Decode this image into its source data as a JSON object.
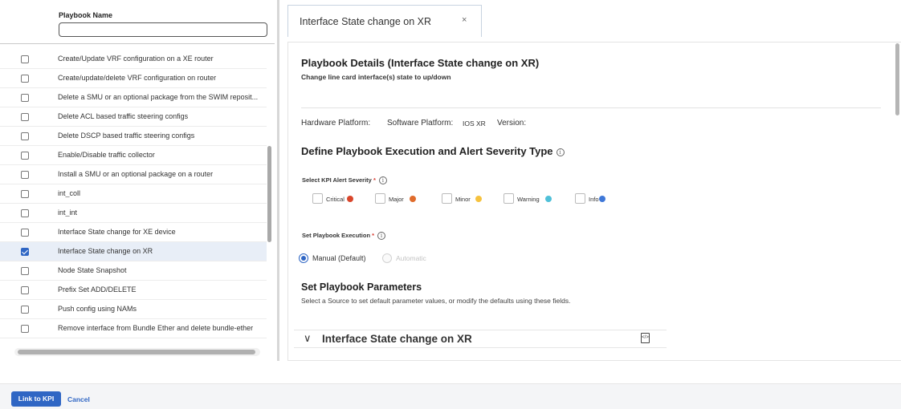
{
  "table": {
    "column_title": "Playbook Name",
    "filter_value": "",
    "rows": [
      {
        "label": "Create/Update VRF configuration on a XE router",
        "checked": false
      },
      {
        "label": "Create/update/delete VRF configuration on router",
        "checked": false
      },
      {
        "label": "Delete a SMU or an optional package from the SWIM reposit...",
        "checked": false
      },
      {
        "label": "Delete ACL based traffic steering configs",
        "checked": false
      },
      {
        "label": "Delete DSCP based traffic steering configs",
        "checked": false
      },
      {
        "label": "Enable/Disable traffic collector",
        "checked": false
      },
      {
        "label": "Install a SMU or an optional package on a router",
        "checked": false
      },
      {
        "label": "int_coll",
        "checked": false
      },
      {
        "label": "int_int",
        "checked": false
      },
      {
        "label": "Interface State change for XE device",
        "checked": false
      },
      {
        "label": "Interface State change on XR",
        "checked": true
      },
      {
        "label": "Node State Snapshot",
        "checked": false
      },
      {
        "label": "Prefix Set ADD/DELETE",
        "checked": false
      },
      {
        "label": "Push config using NAMs",
        "checked": false
      },
      {
        "label": "Remove interface from Bundle Ether and delete bundle-ether",
        "checked": false
      }
    ]
  },
  "tab": {
    "title": "Interface State change on XR",
    "close_glyph": "×"
  },
  "details": {
    "title": "Playbook Details (Interface State change on XR)",
    "subtitle": "Change line card interface(s) state to up/down",
    "hardware_label": "Hardware Platform:",
    "software_label": "Software Platform:",
    "software_value": "IOS XR",
    "version_label": "Version:"
  },
  "execution": {
    "heading": "Define Playbook Execution and Alert Severity Type",
    "severity_label": "Select KPI Alert Severity",
    "severities": [
      {
        "label": "Critical",
        "color": "#d9462b"
      },
      {
        "label": "Major",
        "color": "#e06c2c"
      },
      {
        "label": "Minor",
        "color": "#f6c23e"
      },
      {
        "label": "Warning",
        "color": "#4fc0d8"
      },
      {
        "label": "Info",
        "color": "#3f78d8"
      }
    ],
    "mode_label": "Set Playbook Execution",
    "modes": [
      {
        "label": "Manual (Default)",
        "selected": true
      },
      {
        "label": "Automatic",
        "selected": false
      }
    ],
    "required_mark": "*",
    "info_glyph": "i"
  },
  "parameters": {
    "heading": "Set Playbook Parameters",
    "description": "Select a Source to set default parameter values, or modify the defaults using these fields.",
    "section_title": "Interface State change on XR",
    "chevron": "∨",
    "code_icon_glyph": "</>"
  },
  "footer": {
    "primary_label": "Link to KPI",
    "cancel_label": "Cancel"
  },
  "colors": {
    "accent": "#2f66c4"
  }
}
